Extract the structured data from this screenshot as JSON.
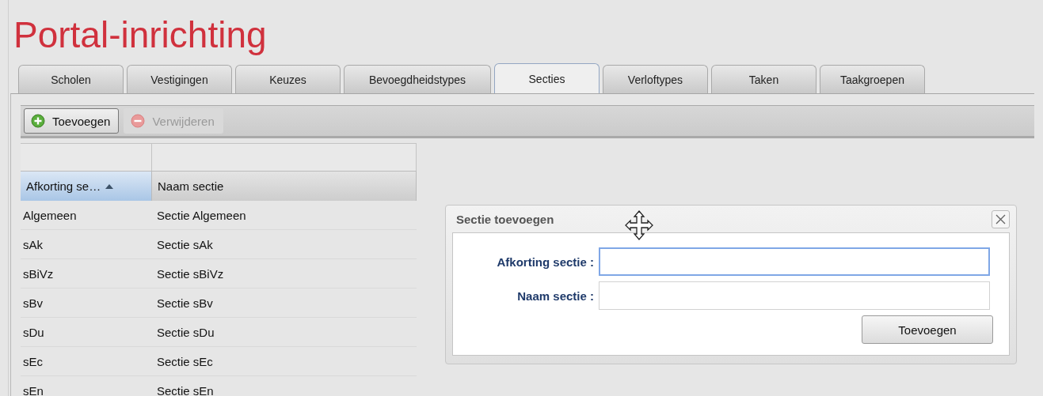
{
  "title": "Portal-inrichting",
  "tabs": [
    {
      "label": "Scholen",
      "selected": false
    },
    {
      "label": "Vestigingen",
      "selected": false
    },
    {
      "label": "Keuzes",
      "selected": false
    },
    {
      "label": "Bevoegdheidstypes",
      "selected": false
    },
    {
      "label": "Secties",
      "selected": true
    },
    {
      "label": "Verloftypes",
      "selected": false
    },
    {
      "label": "Taken",
      "selected": false
    },
    {
      "label": "Taakgroepen",
      "selected": false
    }
  ],
  "toolbar": [
    {
      "label": "Toevoegen",
      "kind": "add",
      "disabled": false
    },
    {
      "label": "Verwijderen",
      "kind": "remove",
      "disabled": true
    }
  ],
  "table": {
    "columns": [
      {
        "label": "Afkorting se…",
        "sorted": true
      },
      {
        "label": "Naam sectie",
        "sorted": false
      }
    ],
    "rows": [
      [
        "Algemeen",
        "Sectie Algemeen"
      ],
      [
        "sAk",
        "Sectie sAk"
      ],
      [
        "sBiVz",
        "Sectie sBiVz"
      ],
      [
        "sBv",
        "Sectie sBv"
      ],
      [
        "sDu",
        "Sectie sDu"
      ],
      [
        "sEc",
        "Sectie sEc"
      ],
      [
        "sEn",
        "Sectie sEn"
      ]
    ]
  },
  "dialog": {
    "title": "Sectie toevoegen",
    "fields": [
      {
        "label": "Afkorting sectie :",
        "focused": true
      },
      {
        "label": "Naam sectie :",
        "focused": false
      }
    ],
    "button": "Toevoegen"
  }
}
